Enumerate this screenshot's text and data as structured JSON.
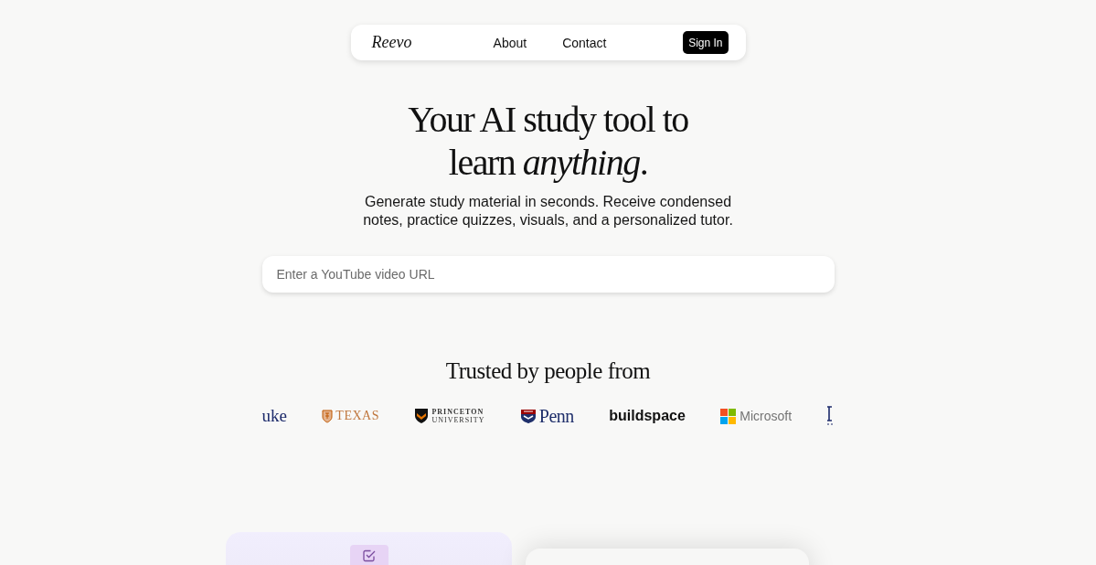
{
  "nav": {
    "brand": "Reevo",
    "links": [
      "About",
      "Contact"
    ],
    "button": "Sign In"
  },
  "hero": {
    "title": "Your AI study tool to learn *anything*.",
    "subtitle": "Generate study material in seconds. Receive condensed notes, practice quizzes, visuals, and a personalized tutor."
  },
  "url_input": {
    "placeholder": "Enter a YouTube video URL"
  },
  "trusted": {
    "heading": "Trusted by people from",
    "logos": [
      {
        "kind": "duke",
        "text": "uke"
      },
      {
        "kind": "texas",
        "text": "TEXAS"
      },
      {
        "kind": "princeton",
        "text": "PRINCETON",
        "subtext": "UNIVERSITY"
      },
      {
        "kind": "penn",
        "text": "Penn"
      },
      {
        "kind": "buildspace",
        "text": "buildspace"
      },
      {
        "kind": "microsoft",
        "text": "Microsoft"
      },
      {
        "kind": "cropped"
      }
    ]
  },
  "cards": [
    {
      "kind": "checklist"
    },
    {
      "kind": "blank"
    }
  ]
}
